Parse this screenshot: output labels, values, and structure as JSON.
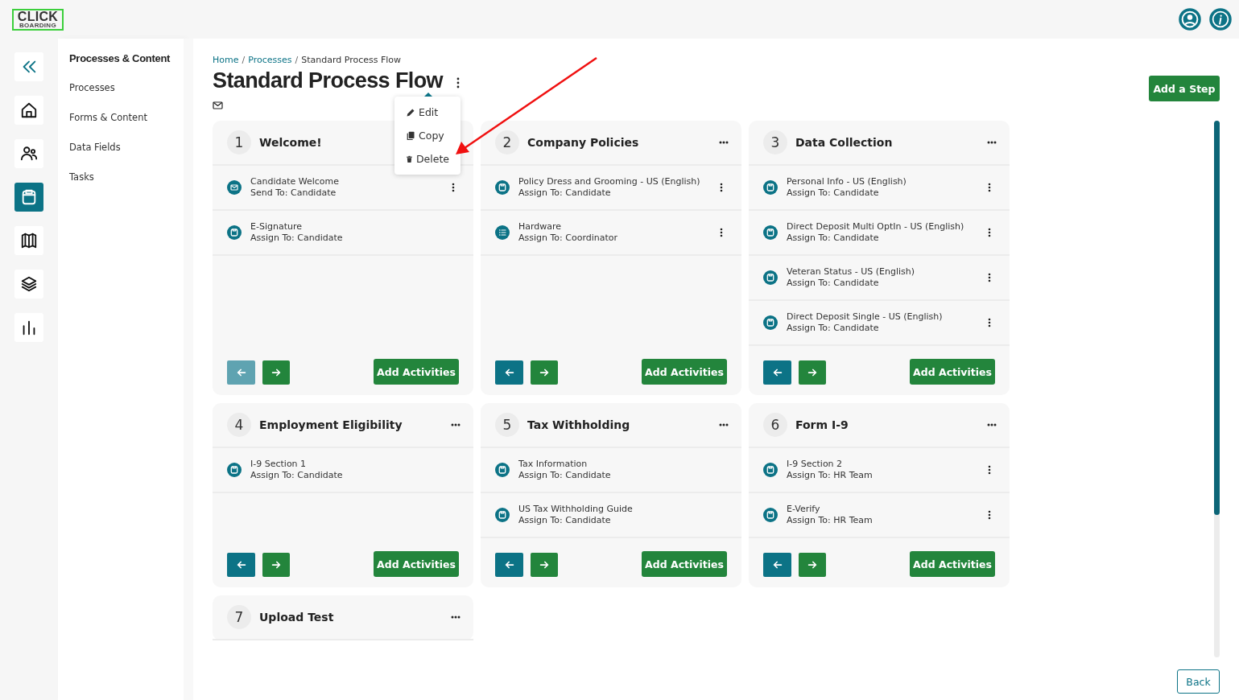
{
  "header": {
    "logo_text": "CLICK",
    "logo_subtext": "BOARDING"
  },
  "rail": [
    {
      "kind": "collapse",
      "selected": false
    },
    {
      "kind": "home",
      "selected": false
    },
    {
      "kind": "people",
      "selected": false
    },
    {
      "kind": "clipboard",
      "selected": true
    },
    {
      "kind": "map",
      "selected": false
    },
    {
      "kind": "layers",
      "selected": false
    },
    {
      "kind": "bars",
      "selected": false
    }
  ],
  "sidebar": {
    "title": "Processes & Content",
    "items": [
      "Processes",
      "Forms & Content",
      "Data Fields",
      "Tasks"
    ]
  },
  "breadcrumbs": {
    "separator": "/",
    "items": [
      {
        "label": "Home",
        "link": true
      },
      {
        "label": "Processes",
        "link": true
      },
      {
        "label": "Standard Process Flow",
        "link": false
      }
    ]
  },
  "page_title": "Standard Process Flow",
  "title_menu": [
    {
      "kind": "edit",
      "label": "Edit"
    },
    {
      "kind": "copy",
      "label": "Copy"
    },
    {
      "kind": "delete",
      "label": "Delete"
    }
  ],
  "add_step": "Add a Step",
  "steps": [
    {
      "number": "1",
      "title": "Welcome!",
      "options_visible": false,
      "prev_disabled": true,
      "add_label": "Add Activities",
      "activities": [
        {
          "kind": "email",
          "name": "Candidate Welcome",
          "assignee": "Send To: Candidate",
          "menu": true
        },
        {
          "kind": "form",
          "name": "E-Signature",
          "assignee": "Assign To: Candidate",
          "menu": false
        }
      ]
    },
    {
      "number": "2",
      "title": "Company Policies",
      "options_visible": true,
      "prev_disabled": false,
      "add_label": "Add Activities",
      "activities": [
        {
          "kind": "form",
          "name": "Policy Dress and Grooming - US (English)",
          "assignee": "Assign To: Candidate",
          "menu": true
        },
        {
          "kind": "list",
          "name": "Hardware",
          "assignee": "Assign To: Coordinator",
          "menu": true
        }
      ]
    },
    {
      "number": "3",
      "title": "Data Collection",
      "options_visible": true,
      "prev_disabled": false,
      "add_label": "Add Activities",
      "activities": [
        {
          "kind": "form",
          "name": "Personal Info - US (English)",
          "assignee": "Assign To: Candidate",
          "menu": true
        },
        {
          "kind": "form",
          "name": "Direct Deposit Multi OptIn - US (English)",
          "assignee": "Assign To: Candidate",
          "menu": true
        },
        {
          "kind": "form",
          "name": "Veteran Status - US (English)",
          "assignee": "Assign To: Candidate",
          "menu": true
        },
        {
          "kind": "form",
          "name": "Direct Deposit Single - US (English)",
          "assignee": "Assign To: Candidate",
          "menu": true
        }
      ]
    },
    {
      "number": "4",
      "title": "Employment Eligibility",
      "options_visible": true,
      "prev_disabled": false,
      "add_label": "Add Activities",
      "activities": [
        {
          "kind": "form",
          "name": "I-9 Section 1",
          "assignee": "Assign To: Candidate",
          "menu": false
        }
      ]
    },
    {
      "number": "5",
      "title": "Tax Withholding",
      "options_visible": true,
      "prev_disabled": false,
      "add_label": "Add Activities",
      "activities": [
        {
          "kind": "form",
          "name": "Tax Information",
          "assignee": "Assign To: Candidate",
          "menu": false
        },
        {
          "kind": "form",
          "name": "US Tax Withholding Guide",
          "assignee": "Assign To: Candidate",
          "menu": false
        }
      ]
    },
    {
      "number": "6",
      "title": "Form I-9",
      "options_visible": true,
      "prev_disabled": false,
      "add_label": "Add Activities",
      "activities": [
        {
          "kind": "form",
          "name": "I-9 Section 2",
          "assignee": "Assign To: HR Team",
          "menu": true
        },
        {
          "kind": "form",
          "name": "E-Verify",
          "assignee": "Assign To: HR Team",
          "menu": true
        }
      ]
    },
    {
      "number": "7",
      "title": "Upload Test",
      "options_visible": true
    }
  ],
  "back": "Back"
}
